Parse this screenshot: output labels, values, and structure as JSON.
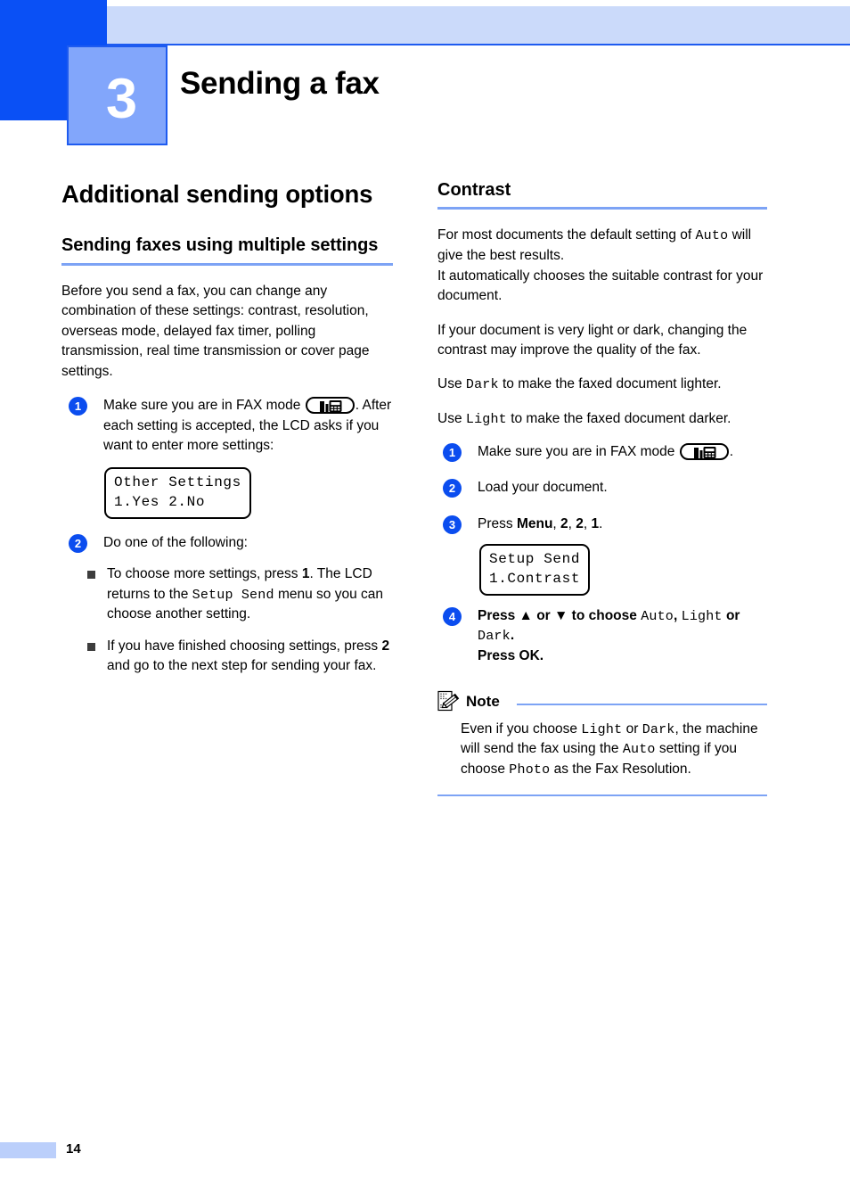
{
  "chapter": {
    "number": "3",
    "title": "Sending a fax"
  },
  "colors": {
    "header_dark_blue": "#0A50F5",
    "header_light_blue": "#CBDAFA",
    "chapter_box_blue": "#82A6FB",
    "rule_blue": "#7DA3F5",
    "badge_blue": "#0B4DEF",
    "footer_bar_blue": "#BBCFFB"
  },
  "left_column": {
    "section_heading": "Additional sending options",
    "sub_heading": "Sending faxes using multiple settings",
    "intro": "Before you send a fax, you can change any combination of these settings: contrast, resolution, overseas mode, delayed fax timer, polling transmission, real time transmission or cover page settings.",
    "step1": {
      "badge": "1",
      "text_before_icon": "Make sure you are in FAX mode ",
      "icon": "fax-mode-icon",
      "text_after_icon": ".",
      "continued": "After each setting is accepted, the LCD asks if you want to enter more settings:"
    },
    "lcd1": {
      "line1": "Other Settings",
      "line2": "1.Yes 2.No"
    },
    "step2": {
      "badge": "2",
      "text": "Do one of the following:"
    },
    "bullets": [
      {
        "part1": "To choose more settings, press ",
        "bold1": "1",
        "part2": ". The LCD returns to the ",
        "mono1": "Setup Send",
        "part3": " menu so you can choose another setting."
      },
      {
        "part1": "If you have finished choosing settings, press ",
        "bold1": "2",
        "part2": " and go to the next step for sending your fax."
      }
    ]
  },
  "right_column": {
    "heading": "Contrast",
    "para1": {
      "part1": "For most documents the default setting of ",
      "mono1": "Auto",
      "part2": " will give the best results.",
      "part3": "It automatically chooses the suitable contrast for your document."
    },
    "para2": "If your document is very light or dark, changing the contrast may improve the quality of the fax.",
    "para3": {
      "part1": "Use ",
      "mono1": "Dark",
      "part2": " to make the faxed document lighter."
    },
    "para4": {
      "part1": "Use ",
      "mono1": "Light",
      "part2": " to make the faxed document darker."
    },
    "step1": {
      "badge": "1",
      "text_before_icon": "Make sure you are in FAX mode ",
      "icon": "fax-mode-icon",
      "text_after_icon": "."
    },
    "step2": {
      "badge": "2",
      "text": "Load your document."
    },
    "step3": {
      "badge": "3",
      "part1": "Press ",
      "bold1": "Menu",
      "part2": ", ",
      "bold2": "2",
      "part3": ", ",
      "bold3": "2",
      "part4": ", ",
      "bold4": "1",
      "part5": "."
    },
    "lcd2": {
      "line1": "Setup Send",
      "line2": "1.Contrast"
    },
    "step4": {
      "badge": "4",
      "part1": "Press ",
      "arrow_up": "▲",
      "part2": " or ",
      "arrow_down": "▼",
      "part3": " to choose ",
      "mono1": "Auto",
      "part4": ", ",
      "mono2": "Light",
      "part5": " or ",
      "mono3": "Dark",
      "part6": ".",
      "part7": "Press ",
      "bold1": "OK",
      "part8": "."
    },
    "note": {
      "icon": "note-pencil-icon",
      "label": "Note",
      "part1": "Even if you choose ",
      "mono1": "Light",
      "part2": " or ",
      "mono2": "Dark",
      "part3": ", the machine will send the fax using the ",
      "mono3": "Auto",
      "part4": " setting if you choose ",
      "mono4": "Photo",
      "part5": " as the Fax Resolution."
    }
  },
  "footer": {
    "page_number": "14"
  }
}
